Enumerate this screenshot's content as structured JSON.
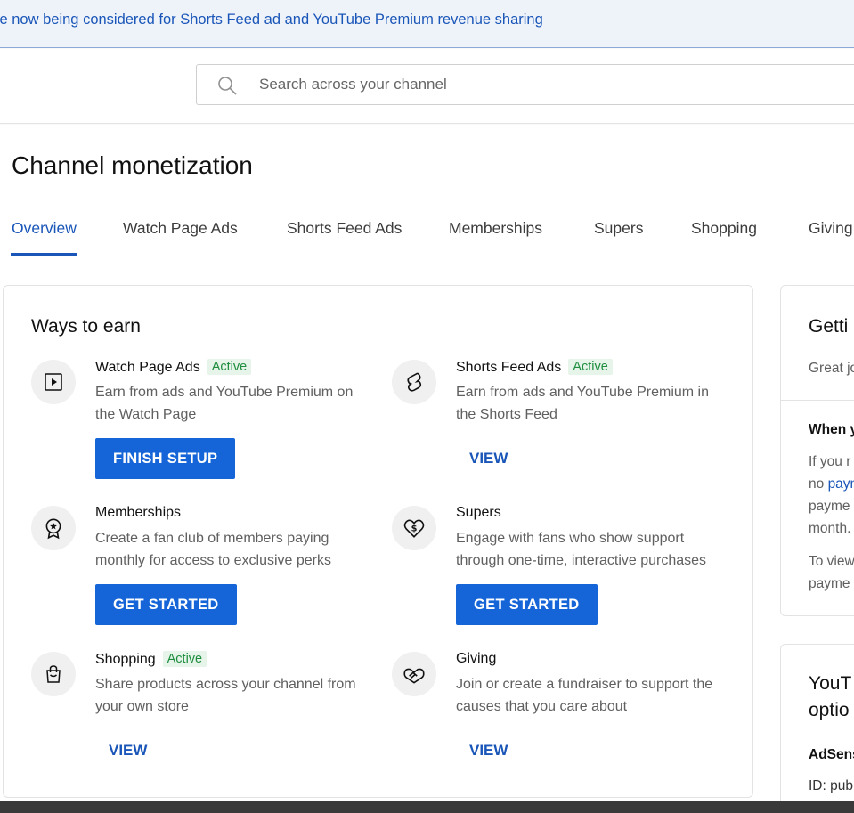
{
  "banner": {
    "text": "re now being considered for Shorts Feed ad and YouTube Premium revenue sharing"
  },
  "search": {
    "placeholder": "Search across your channel",
    "icon": "search-icon"
  },
  "page": {
    "title": "Channel monetization"
  },
  "tabs": [
    {
      "label": "Overview",
      "active": true
    },
    {
      "label": "Watch Page Ads",
      "active": false
    },
    {
      "label": "Shorts Feed Ads",
      "active": false
    },
    {
      "label": "Memberships",
      "active": false
    },
    {
      "label": "Supers",
      "active": false
    },
    {
      "label": "Shopping",
      "active": false
    },
    {
      "label": "Giving",
      "active": false
    }
  ],
  "ways_to_earn": {
    "title": "Ways to earn",
    "items": [
      {
        "name": "Watch Page Ads",
        "badge": "Active",
        "desc": "Earn from ads and YouTube Premium on the Watch Page",
        "action": "FINISH SETUP",
        "icon": "play-icon"
      },
      {
        "name": "Shorts Feed Ads",
        "badge": "Active",
        "desc": "Earn from ads and YouTube Premium in the Shorts Feed",
        "action": "VIEW",
        "icon": "shorts-icon"
      },
      {
        "name": "Memberships",
        "badge": "",
        "desc": "Create a fan club of members paying monthly for access to exclusive perks",
        "action": "GET STARTED",
        "icon": "membership-badge-icon"
      },
      {
        "name": "Supers",
        "badge": "",
        "desc": "Engage with fans who show support through one-time, interactive purchases",
        "action": "GET STARTED",
        "icon": "heart-dollar-icon"
      },
      {
        "name": "Shopping",
        "badge": "Active",
        "desc": "Share products across your channel from your own store",
        "action": "VIEW",
        "icon": "shopping-bag-icon"
      },
      {
        "name": "Giving",
        "badge": "",
        "desc": "Join or create a fundraiser to support the causes that you care about",
        "action": "VIEW",
        "icon": "handshake-heart-icon"
      }
    ]
  },
  "side_card_1": {
    "title": "Getti",
    "line1": "Great jo",
    "subheading": "When y",
    "para_lines": [
      "If you r",
      "no ",
      "paym",
      "payme",
      "month."
    ],
    "para2_lines": [
      "To view",
      "payme"
    ]
  },
  "side_card_2": {
    "title_lines": [
      "YouT",
      "optio"
    ],
    "adsense_label": "AdSens",
    "id_text": "ID: pub"
  },
  "colors": {
    "accent": "#1a56b8",
    "button": "#1565d8",
    "active_badge_bg": "#e6f4ea",
    "active_badge_fg": "#1e8e3e"
  }
}
